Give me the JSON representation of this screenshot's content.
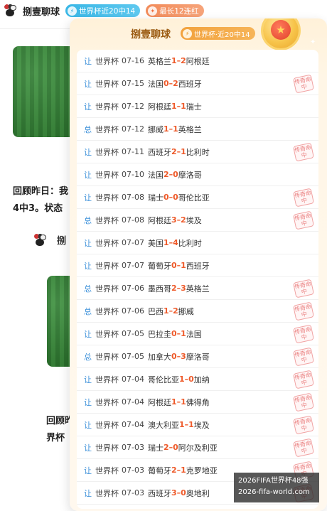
{
  "header": {
    "author": "捌壹聊球",
    "badges": [
      {
        "icon": "lightning-icon",
        "label": "世界杯近20中14",
        "color": "#39b7e6"
      },
      {
        "icon": "flame-icon",
        "label": "最长12连红",
        "color": "#f28b5a"
      }
    ]
  },
  "background": {
    "recap_text": "回顾昨日：我 4中3。状态",
    "mini_author": "捌",
    "recap_text2": "回顾昨 界杯"
  },
  "panel": {
    "title": "捌壹聊球",
    "badge": {
      "icon": "lightning-icon",
      "label": "世界杯·近20中14"
    },
    "medal_icon": "star-icon",
    "stamp_text": "传奇命中",
    "matches": [
      {
        "kind": "让",
        "league": "世界杯",
        "date": "07-16",
        "home": "英格兰",
        "home_score": "1",
        "away_score": "2",
        "away": "阿根廷",
        "hit": false
      },
      {
        "kind": "让",
        "league": "世界杯",
        "date": "07-15",
        "home": "法国",
        "home_score": "0",
        "away_score": "2",
        "away": "西班牙",
        "hit": true
      },
      {
        "kind": "让",
        "league": "世界杯",
        "date": "07-12",
        "home": "阿根廷",
        "home_score": "1",
        "away_score": "1",
        "away": "瑞士",
        "hit": false
      },
      {
        "kind": "总",
        "league": "世界杯",
        "date": "07-12",
        "home": "挪威",
        "home_score": "1",
        "away_score": "1",
        "away": "英格兰",
        "hit": false
      },
      {
        "kind": "让",
        "league": "世界杯",
        "date": "07-11",
        "home": "西班牙",
        "home_score": "2",
        "away_score": "1",
        "away": "比利时",
        "hit": true
      },
      {
        "kind": "让",
        "league": "世界杯",
        "date": "07-10",
        "home": "法国",
        "home_score": "2",
        "away_score": "0",
        "away": "摩洛哥",
        "hit": false
      },
      {
        "kind": "让",
        "league": "世界杯",
        "date": "07-08",
        "home": "瑞士",
        "home_score": "0",
        "away_score": "0",
        "away": "哥伦比亚",
        "hit": true
      },
      {
        "kind": "总",
        "league": "世界杯",
        "date": "07-08",
        "home": "阿根廷",
        "home_score": "3",
        "away_score": "2",
        "away": "埃及",
        "hit": true
      },
      {
        "kind": "让",
        "league": "世界杯",
        "date": "07-07",
        "home": "美国",
        "home_score": "1",
        "away_score": "4",
        "away": "比利时",
        "hit": false
      },
      {
        "kind": "让",
        "league": "世界杯",
        "date": "07-07",
        "home": "葡萄牙",
        "home_score": "0",
        "away_score": "1",
        "away": "西班牙",
        "hit": false
      },
      {
        "kind": "总",
        "league": "世界杯",
        "date": "07-06",
        "home": "墨西哥",
        "home_score": "2",
        "away_score": "3",
        "away": "英格兰",
        "hit": true
      },
      {
        "kind": "总",
        "league": "世界杯",
        "date": "07-06",
        "home": "巴西",
        "home_score": "1",
        "away_score": "2",
        "away": "挪威",
        "hit": true
      },
      {
        "kind": "让",
        "league": "世界杯",
        "date": "07-05",
        "home": "巴拉圭",
        "home_score": "0",
        "away_score": "1",
        "away": "法国",
        "hit": true
      },
      {
        "kind": "总",
        "league": "世界杯",
        "date": "07-05",
        "home": "加拿大",
        "home_score": "0",
        "away_score": "3",
        "away": "摩洛哥",
        "hit": true
      },
      {
        "kind": "让",
        "league": "世界杯",
        "date": "07-04",
        "home": "哥伦比亚",
        "home_score": "1",
        "away_score": "0",
        "away": "加纳",
        "hit": true
      },
      {
        "kind": "让",
        "league": "世界杯",
        "date": "07-04",
        "home": "阿根廷",
        "home_score": "1",
        "away_score": "1",
        "away": "佛得角",
        "hit": true
      },
      {
        "kind": "让",
        "league": "世界杯",
        "date": "07-04",
        "home": "澳大利亚",
        "home_score": "1",
        "away_score": "1",
        "away": "埃及",
        "hit": true
      },
      {
        "kind": "让",
        "league": "世界杯",
        "date": "07-03",
        "home": "瑞士",
        "home_score": "2",
        "away_score": "0",
        "away": "阿尔及利亚",
        "hit": true
      },
      {
        "kind": "让",
        "league": "世界杯",
        "date": "07-03",
        "home": "葡萄牙",
        "home_score": "2",
        "away_score": "1",
        "away": "克罗地亚",
        "hit": true
      },
      {
        "kind": "让",
        "league": "世界杯",
        "date": "07-03",
        "home": "西班牙",
        "home_score": "3",
        "away_score": "0",
        "away": "奥地利",
        "hit": true
      }
    ]
  },
  "watermark": {
    "line1": "2026FIFA世界杯48强",
    "line2": "2026-fifa-world.com"
  }
}
